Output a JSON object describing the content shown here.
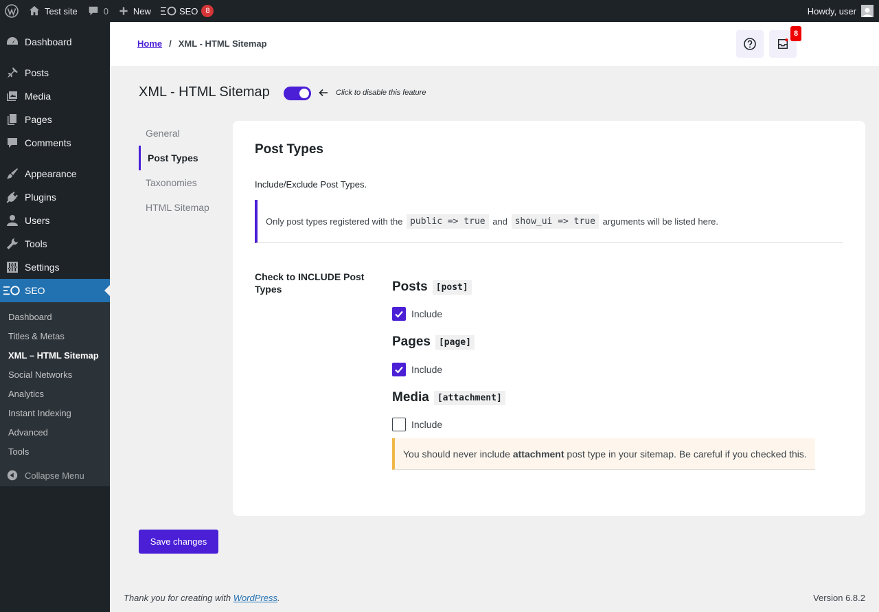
{
  "adminbar": {
    "site_name": "Test site",
    "comments_count": "0",
    "new_label": "New",
    "seo_label": "SEO",
    "seo_badge": "8",
    "howdy": "Howdy, user"
  },
  "sidebar": {
    "items": [
      {
        "label": "Dashboard",
        "icon": "dashboard-icon"
      },
      {
        "label": "Posts",
        "icon": "pin-icon"
      },
      {
        "label": "Media",
        "icon": "media-icon"
      },
      {
        "label": "Pages",
        "icon": "pages-icon"
      },
      {
        "label": "Comments",
        "icon": "comment-icon"
      },
      {
        "label": "Appearance",
        "icon": "brush-icon"
      },
      {
        "label": "Plugins",
        "icon": "plug-icon"
      },
      {
        "label": "Users",
        "icon": "user-icon"
      },
      {
        "label": "Tools",
        "icon": "wrench-icon"
      },
      {
        "label": "Settings",
        "icon": "sliders-icon"
      },
      {
        "label": "SEO",
        "icon": "seo-icon"
      }
    ],
    "submenu": [
      "Dashboard",
      "Titles & Metas",
      "XML – HTML Sitemap",
      "Social Networks",
      "Analytics",
      "Instant Indexing",
      "Advanced",
      "Tools"
    ],
    "collapse_label": "Collapse Menu"
  },
  "header": {
    "breadcrumb_home": "Home",
    "breadcrumb_sep": "/",
    "breadcrumb_current": "XML - HTML Sitemap",
    "notifications_badge": "8"
  },
  "page": {
    "title": "XML - HTML Sitemap",
    "toggle_hint": "Click to disable this feature",
    "toggle_on": true
  },
  "tabs": [
    "General",
    "Post Types",
    "Taxonomies",
    "HTML Sitemap"
  ],
  "card": {
    "title": "Post Types",
    "description": "Include/Exclude Post Types.",
    "notice_before": "Only post types registered with the",
    "notice_code1": "public => true",
    "notice_and": "and",
    "notice_code2": "show_ui => true",
    "notice_after": "arguments will be listed here.",
    "field_label": "Check to INCLUDE Post Types",
    "post_types": [
      {
        "name": "Posts",
        "slug": "[post]",
        "include_label": "Include",
        "checked": true
      },
      {
        "name": "Pages",
        "slug": "[page]",
        "include_label": "Include",
        "checked": true
      },
      {
        "name": "Media",
        "slug": "[attachment]",
        "include_label": "Include",
        "checked": false
      }
    ],
    "warning_before": "You should never include",
    "warning_bold": "attachment",
    "warning_after": "post type in your sitemap. Be careful if you checked this."
  },
  "save_label": "Save changes",
  "footer": {
    "thanks_before": "Thank you for creating with",
    "thanks_link": "WordPress",
    "thanks_after": ".",
    "version": "Version 6.8.2"
  },
  "colors": {
    "accent": "#4a1fd6",
    "wp_blue": "#2271b1",
    "admin_dark": "#1d2327",
    "badge_red": "#d63638",
    "warning": "#f0b849"
  }
}
